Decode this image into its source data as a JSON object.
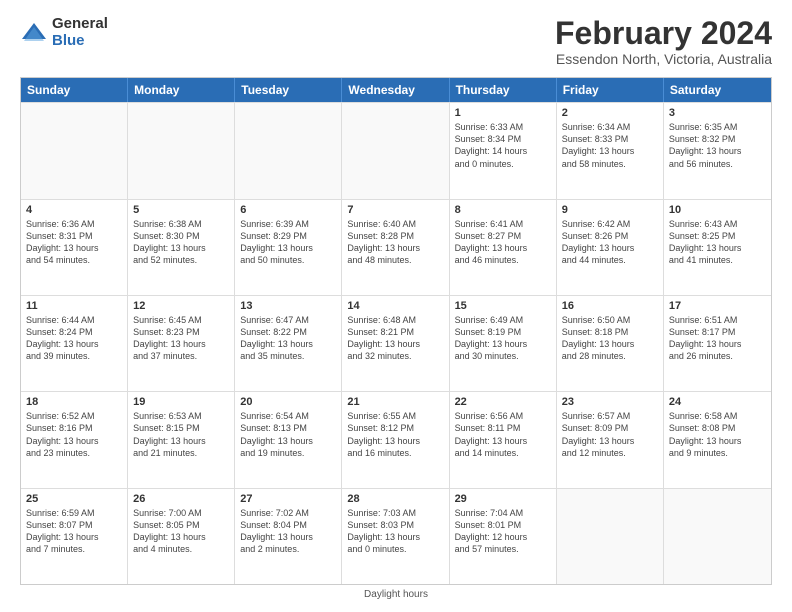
{
  "logo": {
    "general": "General",
    "blue": "Blue"
  },
  "title": "February 2024",
  "location": "Essendon North, Victoria, Australia",
  "days_of_week": [
    "Sunday",
    "Monday",
    "Tuesday",
    "Wednesday",
    "Thursday",
    "Friday",
    "Saturday"
  ],
  "footer": "Daylight hours",
  "weeks": [
    [
      {
        "day": "",
        "detail": ""
      },
      {
        "day": "",
        "detail": ""
      },
      {
        "day": "",
        "detail": ""
      },
      {
        "day": "",
        "detail": ""
      },
      {
        "day": "1",
        "detail": "Sunrise: 6:33 AM\nSunset: 8:34 PM\nDaylight: 14 hours\nand 0 minutes."
      },
      {
        "day": "2",
        "detail": "Sunrise: 6:34 AM\nSunset: 8:33 PM\nDaylight: 13 hours\nand 58 minutes."
      },
      {
        "day": "3",
        "detail": "Sunrise: 6:35 AM\nSunset: 8:32 PM\nDaylight: 13 hours\nand 56 minutes."
      }
    ],
    [
      {
        "day": "4",
        "detail": "Sunrise: 6:36 AM\nSunset: 8:31 PM\nDaylight: 13 hours\nand 54 minutes."
      },
      {
        "day": "5",
        "detail": "Sunrise: 6:38 AM\nSunset: 8:30 PM\nDaylight: 13 hours\nand 52 minutes."
      },
      {
        "day": "6",
        "detail": "Sunrise: 6:39 AM\nSunset: 8:29 PM\nDaylight: 13 hours\nand 50 minutes."
      },
      {
        "day": "7",
        "detail": "Sunrise: 6:40 AM\nSunset: 8:28 PM\nDaylight: 13 hours\nand 48 minutes."
      },
      {
        "day": "8",
        "detail": "Sunrise: 6:41 AM\nSunset: 8:27 PM\nDaylight: 13 hours\nand 46 minutes."
      },
      {
        "day": "9",
        "detail": "Sunrise: 6:42 AM\nSunset: 8:26 PM\nDaylight: 13 hours\nand 44 minutes."
      },
      {
        "day": "10",
        "detail": "Sunrise: 6:43 AM\nSunset: 8:25 PM\nDaylight: 13 hours\nand 41 minutes."
      }
    ],
    [
      {
        "day": "11",
        "detail": "Sunrise: 6:44 AM\nSunset: 8:24 PM\nDaylight: 13 hours\nand 39 minutes."
      },
      {
        "day": "12",
        "detail": "Sunrise: 6:45 AM\nSunset: 8:23 PM\nDaylight: 13 hours\nand 37 minutes."
      },
      {
        "day": "13",
        "detail": "Sunrise: 6:47 AM\nSunset: 8:22 PM\nDaylight: 13 hours\nand 35 minutes."
      },
      {
        "day": "14",
        "detail": "Sunrise: 6:48 AM\nSunset: 8:21 PM\nDaylight: 13 hours\nand 32 minutes."
      },
      {
        "day": "15",
        "detail": "Sunrise: 6:49 AM\nSunset: 8:19 PM\nDaylight: 13 hours\nand 30 minutes."
      },
      {
        "day": "16",
        "detail": "Sunrise: 6:50 AM\nSunset: 8:18 PM\nDaylight: 13 hours\nand 28 minutes."
      },
      {
        "day": "17",
        "detail": "Sunrise: 6:51 AM\nSunset: 8:17 PM\nDaylight: 13 hours\nand 26 minutes."
      }
    ],
    [
      {
        "day": "18",
        "detail": "Sunrise: 6:52 AM\nSunset: 8:16 PM\nDaylight: 13 hours\nand 23 minutes."
      },
      {
        "day": "19",
        "detail": "Sunrise: 6:53 AM\nSunset: 8:15 PM\nDaylight: 13 hours\nand 21 minutes."
      },
      {
        "day": "20",
        "detail": "Sunrise: 6:54 AM\nSunset: 8:13 PM\nDaylight: 13 hours\nand 19 minutes."
      },
      {
        "day": "21",
        "detail": "Sunrise: 6:55 AM\nSunset: 8:12 PM\nDaylight: 13 hours\nand 16 minutes."
      },
      {
        "day": "22",
        "detail": "Sunrise: 6:56 AM\nSunset: 8:11 PM\nDaylight: 13 hours\nand 14 minutes."
      },
      {
        "day": "23",
        "detail": "Sunrise: 6:57 AM\nSunset: 8:09 PM\nDaylight: 13 hours\nand 12 minutes."
      },
      {
        "day": "24",
        "detail": "Sunrise: 6:58 AM\nSunset: 8:08 PM\nDaylight: 13 hours\nand 9 minutes."
      }
    ],
    [
      {
        "day": "25",
        "detail": "Sunrise: 6:59 AM\nSunset: 8:07 PM\nDaylight: 13 hours\nand 7 minutes."
      },
      {
        "day": "26",
        "detail": "Sunrise: 7:00 AM\nSunset: 8:05 PM\nDaylight: 13 hours\nand 4 minutes."
      },
      {
        "day": "27",
        "detail": "Sunrise: 7:02 AM\nSunset: 8:04 PM\nDaylight: 13 hours\nand 2 minutes."
      },
      {
        "day": "28",
        "detail": "Sunrise: 7:03 AM\nSunset: 8:03 PM\nDaylight: 13 hours\nand 0 minutes."
      },
      {
        "day": "29",
        "detail": "Sunrise: 7:04 AM\nSunset: 8:01 PM\nDaylight: 12 hours\nand 57 minutes."
      },
      {
        "day": "",
        "detail": ""
      },
      {
        "day": "",
        "detail": ""
      }
    ]
  ]
}
